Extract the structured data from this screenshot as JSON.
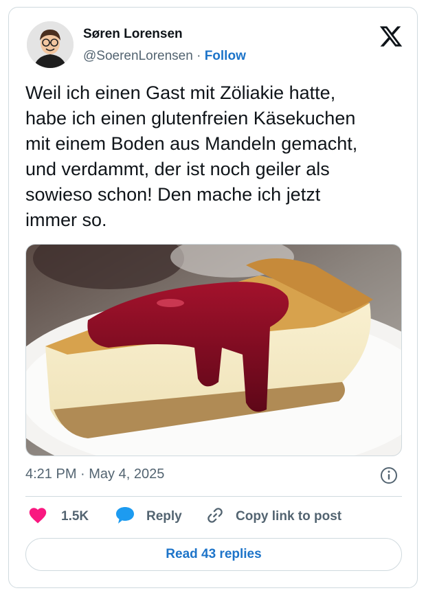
{
  "author": {
    "name": "Søren Lorensen",
    "handle": "@SoerenLorensen",
    "separator": " · ",
    "follow_label": "Follow"
  },
  "tweet": {
    "lines": [
      "Weil ich einen Gast mit Zöliakie hatte,",
      "habe ich einen glutenfreien Käsekuchen",
      "mit einem Boden aus Mandeln gemacht,",
      "und verdammt, der ist noch geiler als",
      "sowieso schon! Den mache ich jetzt",
      "immer so."
    ],
    "timestamp": "4:21 PM · May 4, 2025"
  },
  "actions": {
    "likes": "1.5K",
    "reply": "Reply",
    "copy_link": "Copy link to post"
  },
  "read_replies": "Read 43 replies",
  "icons": {
    "brand": "x-logo-icon",
    "like": "heart-icon",
    "reply": "speech-bubble-icon",
    "copy": "link-icon",
    "info": "info-icon"
  },
  "colors": {
    "link": "#1d74c9",
    "muted": "#536471",
    "like": "#f91880",
    "reply_icon": "#1d9bf0",
    "border": "#cfd9de"
  }
}
